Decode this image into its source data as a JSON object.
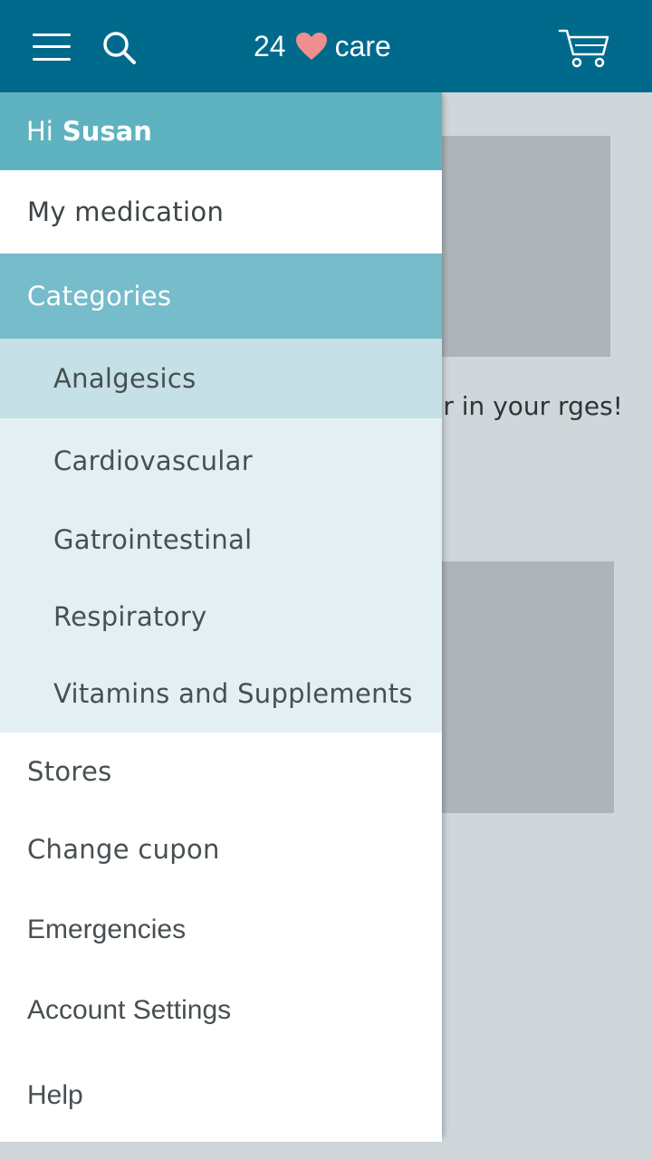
{
  "header": {
    "logo_number": "24",
    "logo_word": "care",
    "icons": [
      "menu-icon",
      "search-icon",
      "heart-icon",
      "cart-icon"
    ]
  },
  "background": {
    "text": "liver in your rges!"
  },
  "drawer": {
    "greeting_prefix": "Hi",
    "user_name": "Susan",
    "my_medication": "My medication",
    "categories_label": "Categories",
    "categories": [
      "Analgesics",
      "Cardiovascular",
      "Gatrointestinal",
      "Respiratory",
      "Vitamins and Supplements"
    ],
    "stores": "Stores",
    "change_cupon": "Change cupon",
    "emergencies": "Emergencies",
    "account_settings": "Account Settings",
    "help": "Help"
  },
  "colors": {
    "topbar": "#006a8c",
    "greeting_bg": "#5fb2c0",
    "categories_bg": "#76bccb",
    "subitem_bg": "#e3eff2",
    "subitem_active_bg": "#c5e0e6",
    "heart": "#f08f8f"
  }
}
